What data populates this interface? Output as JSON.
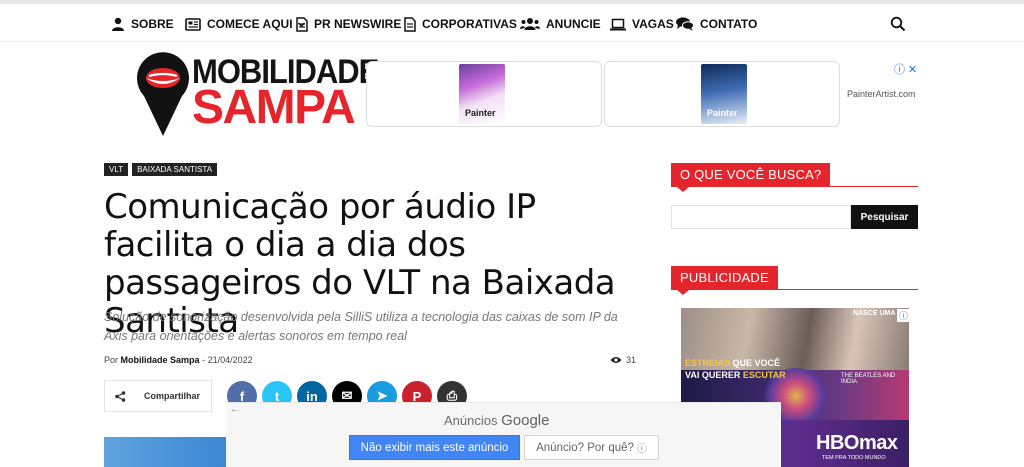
{
  "nav": {
    "items": [
      {
        "label": "SOBRE",
        "icon": "user-icon"
      },
      {
        "label": "COMECE AQUI",
        "icon": "newspaper-icon"
      },
      {
        "label": "PR NEWSWIRE",
        "icon": "document-icon"
      },
      {
        "label": "CORPORATIVAS",
        "icon": "document-icon"
      },
      {
        "label": "ANUNCIE",
        "icon": "users-icon"
      },
      {
        "label": "VAGAS",
        "icon": "laptop-icon"
      },
      {
        "label": "CONTATO",
        "icon": "chat-icon"
      }
    ]
  },
  "logo": {
    "line1": "MOBILIDADE",
    "line2": "SAMPA"
  },
  "banner_ad": {
    "product1": "Painter",
    "product2": "Painter",
    "url": "PainterArtist.com",
    "adchoice": "ⓘ ✕"
  },
  "article": {
    "tags": [
      "VLT",
      "BAIXADA SANTISTA"
    ],
    "title": "Comunicação por áudio IP facilita o dia a dia dos passageiros do VLT na Baixada Santista",
    "subtitle": "Solução de sonorização desenvolvida pela SilliS utiliza a tecnologia das caixas de som IP da Axis para orientações e alertas sonoros em tempo real",
    "author_prefix": "Por",
    "author": "Mobilidade Sampa",
    "date_sep": "-",
    "date": "21/04/2022",
    "views": "31",
    "share_label": "Compartilhar"
  },
  "social_icons": [
    {
      "name": "facebook-icon",
      "glyph": "f",
      "color": "#516eab"
    },
    {
      "name": "twitter-icon",
      "glyph": "t",
      "color": "#29c5f6"
    },
    {
      "name": "linkedin-icon",
      "glyph": "in",
      "color": "#0266a0"
    },
    {
      "name": "email-icon",
      "glyph": "✉",
      "color": "#000000"
    },
    {
      "name": "telegram-icon",
      "glyph": "➤",
      "color": "#179cde"
    },
    {
      "name": "pinterest-icon",
      "glyph": "P",
      "color": "#ca212a"
    },
    {
      "name": "print-icon",
      "glyph": "⎙",
      "color": "#333333"
    }
  ],
  "sidebar": {
    "search_heading": "O QUE VOCÊ BUSCA?",
    "search_button": "Pesquisar",
    "ad_heading": "PUBLICIDADE",
    "ad": {
      "top_right": "NASCE UMA",
      "line1_a": "ESTREIAS",
      "line1_b": " QUE VOCÊ",
      "line2_a": "VAI QUERER ",
      "line2_b": "ESCUTAR",
      "show": "THE BEATLES AND INDIA",
      "brand": "HBOmax",
      "brand_sub": "TEM PRA TODO MUNDO"
    }
  },
  "google_popup": {
    "back": "←",
    "heading_a": "Anúncios ",
    "heading_b": "Google",
    "stop_button": "Não exibir mais este anúncio",
    "why_button": "Anúncio? Por quê?",
    "info_glyph": "ⓘ"
  }
}
